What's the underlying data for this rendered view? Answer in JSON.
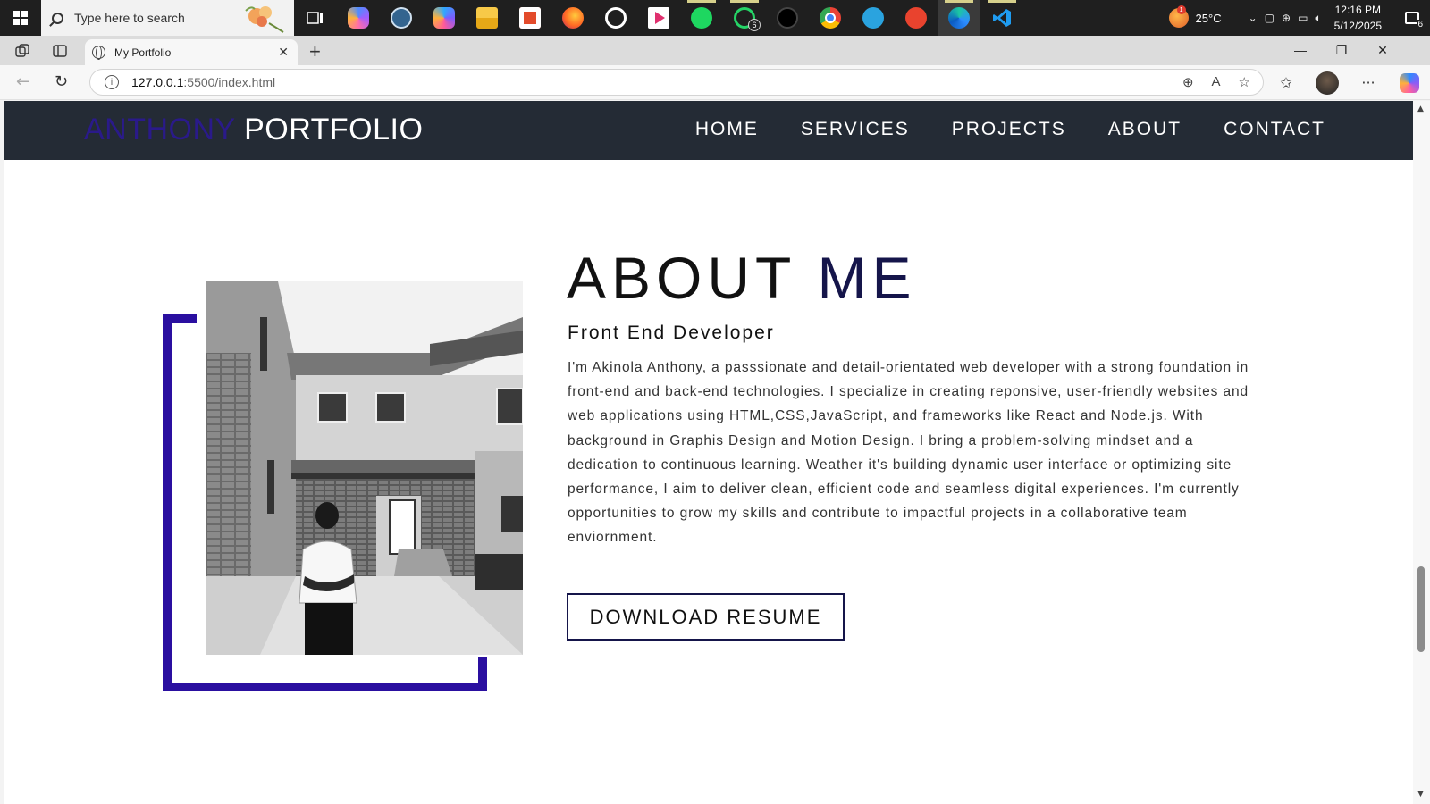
{
  "taskbar": {
    "search_placeholder": "Type here to search",
    "apps": [
      {
        "icon": "task-view-icon"
      },
      {
        "icon": "copilot-app-icon"
      },
      {
        "icon": "postgres-icon"
      },
      {
        "icon": "m365-icon",
        "label": "M365"
      },
      {
        "icon": "file-explorer-icon"
      },
      {
        "icon": "ms-store-icon"
      },
      {
        "icon": "firefox-icon"
      },
      {
        "icon": "chatgpt-icon"
      },
      {
        "icon": "media-player-icon"
      },
      {
        "icon": "spotify-icon"
      },
      {
        "icon": "whatsapp-icon",
        "badge": "6"
      },
      {
        "icon": "tiktok-icon"
      },
      {
        "icon": "chrome-icon"
      },
      {
        "icon": "telegram-icon"
      },
      {
        "icon": "wps-office-icon"
      },
      {
        "icon": "edge-icon"
      },
      {
        "icon": "vscode-icon"
      }
    ],
    "weather_temp": "25°C",
    "weather_badge": "1",
    "time": "12:16 PM",
    "date": "5/12/2025",
    "notifications": "6"
  },
  "browser": {
    "tab_title": "My Portfolio",
    "url_host": "127.0.0.1",
    "url_path": ":5500/index.html"
  },
  "site": {
    "logo_first": "ANTHONY",
    "logo_second": "PORTFOLIO",
    "nav": [
      "HOME",
      "SERVICES",
      "PROJECTS",
      "ABOUT",
      "CONTACT"
    ]
  },
  "about": {
    "title_a": "ABOUT",
    "title_b": "ME",
    "subtitle": "Front End Developer",
    "body": "I'm Akinola Anthony, a passsionate and detail-orientated web developer with a strong foundation in front-end and back-end technologies. I specialize in creating reponsive, user-friendly websites and web applications using HTML,CSS,JavaScript, and frameworks like React and Node.js. With background in Graphis Design and Motion Design. I bring a problem-solving mindset and a dedication to continuous learning. Weather it's building dynamic user interface or optimizing site performance, I aim to deliver clean, efficient code and seamless digital experiences. I'm currently opportunities to grow my skills and contribute to impactful projects in a collaborative team enviornment.",
    "button": "DOWNLOAD RESUME",
    "accent_color": "#2a0fa0"
  }
}
